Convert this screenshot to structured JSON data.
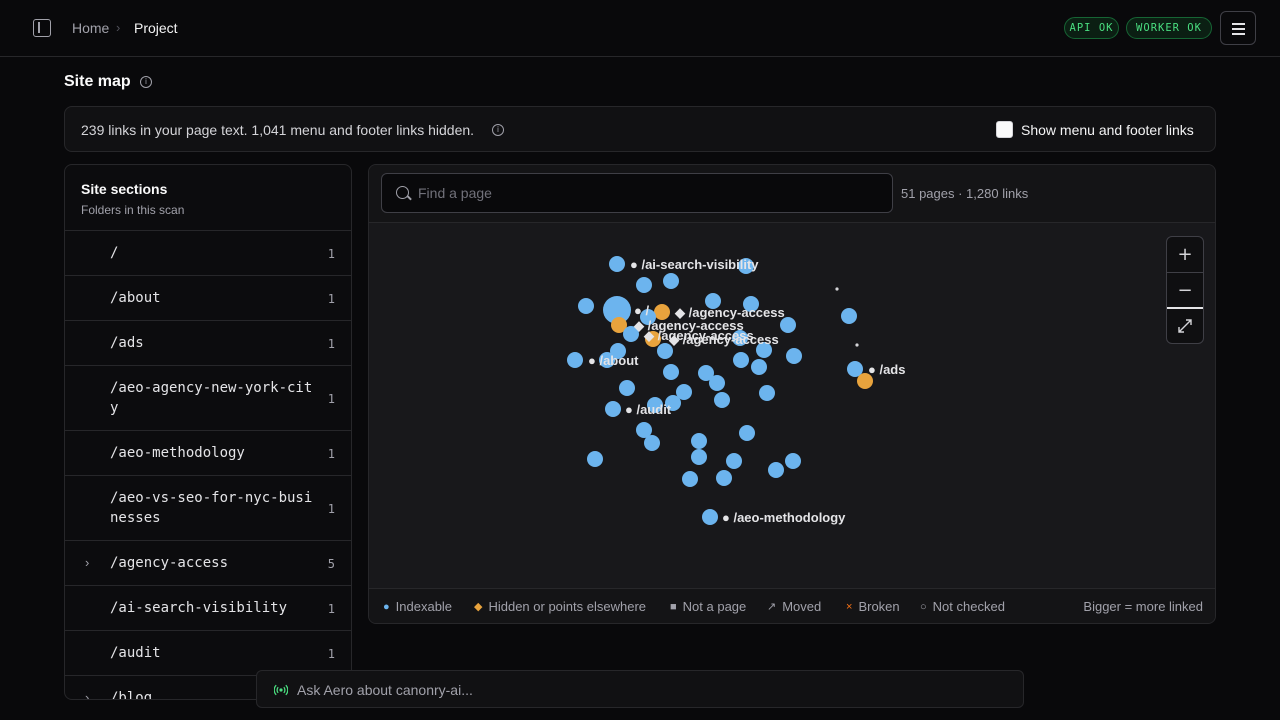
{
  "breadcrumb": {
    "home": "Home",
    "separator": "›",
    "current": "Project"
  },
  "status": {
    "api": "API OK",
    "worker": "WORKER OK",
    "color": "#4ade80"
  },
  "page": {
    "title": "Site map"
  },
  "links_bar": {
    "text": "239 links in your page text. 1,041 menu and footer links hidden.",
    "checkbox_label": "Show menu and footer links",
    "checkbox_checked": false
  },
  "sections": {
    "title": "Site sections",
    "subtitle": "Folders in this scan",
    "items": [
      {
        "path": "/",
        "count": "1",
        "expandable": false
      },
      {
        "path": "/about",
        "count": "1",
        "expandable": false
      },
      {
        "path": "/ads",
        "count": "1",
        "expandable": false
      },
      {
        "path": "/aeo-agency-new-york-city",
        "count": "1",
        "expandable": false
      },
      {
        "path": "/aeo-methodology",
        "count": "1",
        "expandable": false
      },
      {
        "path": "/aeo-vs-seo-for-nyc-businesses",
        "count": "1",
        "expandable": false
      },
      {
        "path": "/agency-access",
        "count": "5",
        "expandable": true
      },
      {
        "path": "/ai-search-visibility",
        "count": "1",
        "expandable": false
      },
      {
        "path": "/audit",
        "count": "1",
        "expandable": false
      },
      {
        "path": "/blog",
        "count": "",
        "expandable": true
      }
    ]
  },
  "graph": {
    "search_placeholder": "Find a page",
    "stats": "51 pages · 1,280 links",
    "zoom_in": "+",
    "zoom_out": "−",
    "fit_icon": "expand-icon",
    "colors": {
      "indexable": "#6cb4ee",
      "hidden": "#e8a33d",
      "label": "#e4e4e7"
    },
    "labels": [
      {
        "text": "● /ai-search-visibility"
      },
      {
        "text": "● /"
      },
      {
        "text": "◆ /agency-access"
      },
      {
        "text": "◆ /agency-access"
      },
      {
        "text": "◆ /agency-access"
      },
      {
        "text": "◆ /agency-access"
      },
      {
        "text": "● /about"
      },
      {
        "text": "● /ads"
      },
      {
        "text": "● /audit"
      },
      {
        "text": "● /aeo-methodology"
      }
    ]
  },
  "legend": {
    "items": [
      {
        "symbol": "●",
        "label": "Indexable",
        "color": "#6cb4ee"
      },
      {
        "symbol": "◆",
        "label": "Hidden or points elsewhere",
        "color": "#e8a33d"
      },
      {
        "symbol": "■",
        "label": "Not a page",
        "color": "#a1a1aa"
      },
      {
        "symbol": "↗",
        "label": "Moved",
        "color": "#a1a1aa"
      },
      {
        "symbol": "×",
        "label": "Broken",
        "color": "#f97316"
      },
      {
        "symbol": "○",
        "label": "Not checked",
        "color": "#a1a1aa"
      }
    ],
    "note": "Bigger = more linked"
  },
  "assistant": {
    "placeholder": "Ask Aero about canonry-ai..."
  }
}
